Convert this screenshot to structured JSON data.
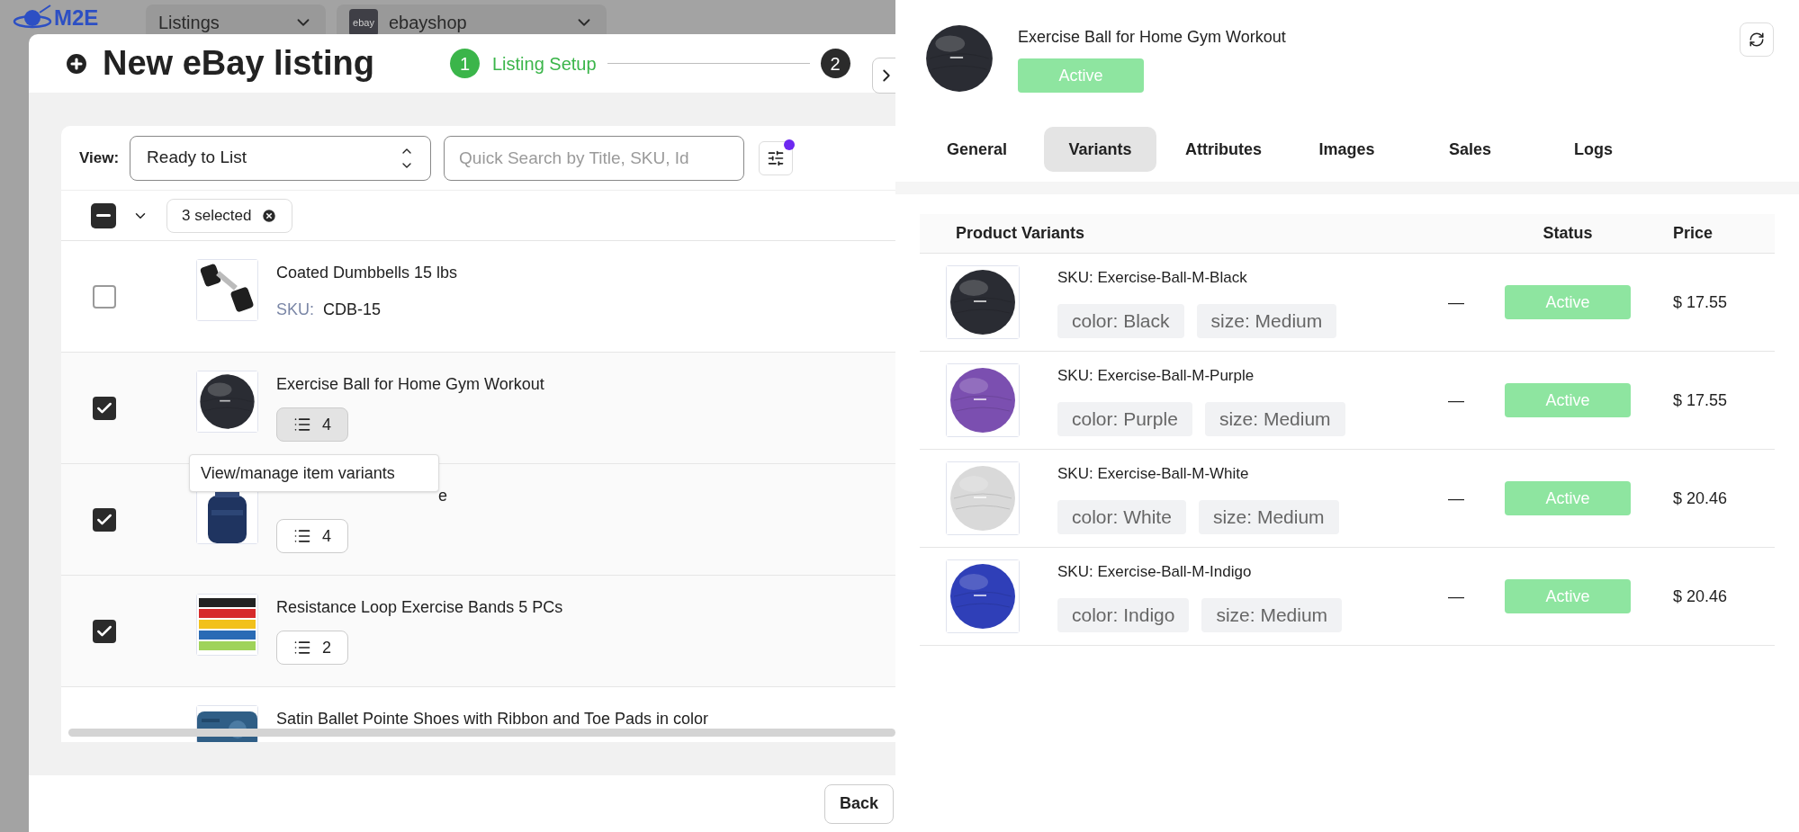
{
  "top_bar": {
    "logo": "M2E",
    "dropdowns": [
      {
        "label": "Listings"
      },
      {
        "label": "ebayshop",
        "logo_text": "ebay"
      }
    ]
  },
  "modal": {
    "title": "New eBay listing",
    "steps": [
      {
        "number": "1",
        "label": "Listing Setup",
        "selected": true
      },
      {
        "number": "2",
        "selected": false
      }
    ],
    "view_label": "View:",
    "view_value": "Ready to List",
    "search": {
      "placeholder": "Quick Search by Title, SKU, Id"
    },
    "filter_active": true,
    "bulk": {
      "selected_text": "3 selected",
      "select_all_indeterminate": true
    },
    "rows": [
      {
        "kind": "simple",
        "title": "Coated Dumbbells 15 lbs",
        "sku_label": "SKU:",
        "sku": "CDB-15",
        "checked": false
      },
      {
        "kind": "variants",
        "title": "Exercise Ball for Home Gym Workout",
        "variant_count": "4",
        "checked": true,
        "hovered": true
      },
      {
        "kind": "variants",
        "title": "e",
        "variant_count": "4",
        "checked": true,
        "covered": true,
        "hovered": false
      },
      {
        "kind": "variants",
        "title": "Resistance Loop Exercise Bands 5 PCs",
        "variant_count": "2",
        "checked": true,
        "hovered": false
      },
      {
        "kind": "cut",
        "title": "Satin Ballet Pointe Shoes with Ribbon and Toe Pads in color"
      }
    ],
    "tooltip": "View/manage item variants",
    "back_button": "Back"
  },
  "panel": {
    "title": "Exercise Ball for Home Gym Workout",
    "status": "Active",
    "tabs": [
      {
        "label": "General",
        "selected": false
      },
      {
        "label": "Variants",
        "selected": true
      },
      {
        "label": "Attributes",
        "selected": false
      },
      {
        "label": "Images",
        "selected": false
      },
      {
        "label": "Sales",
        "selected": false
      },
      {
        "label": "Logs",
        "selected": false
      }
    ],
    "table": {
      "columns": [
        "Product Variants",
        "Status",
        "Price"
      ],
      "rows": [
        {
          "sku": "SKU: Exercise-Ball-M-Black",
          "options": [
            "color: Black",
            "size: Medium"
          ],
          "column_3": "—",
          "status": "Active",
          "price": "$ 17.55"
        },
        {
          "sku": "SKU: Exercise-Ball-M-Purple",
          "options": [
            "color: Purple",
            "size: Medium"
          ],
          "column_3": "—",
          "status": "Active",
          "price": "$ 17.55"
        },
        {
          "sku": "SKU: Exercise-Ball-M-White",
          "options": [
            "color: White",
            "size: Medium"
          ],
          "column_3": "—",
          "status": "Active",
          "price": "$ 20.46"
        },
        {
          "sku": "SKU: Exercise-Ball-M-Indigo",
          "options": [
            "color: Indigo",
            "size: Medium"
          ],
          "column_3": "—",
          "status": "Active",
          "price": "$ 20.46"
        }
      ]
    }
  }
}
